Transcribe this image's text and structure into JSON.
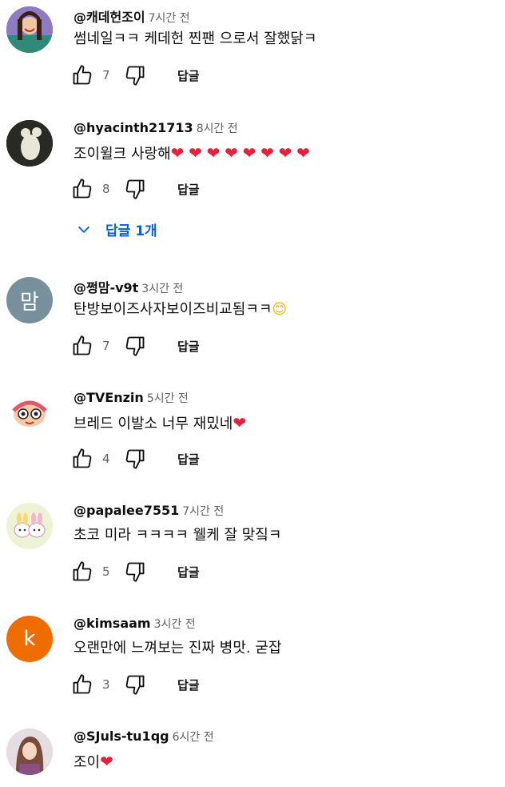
{
  "comments": [
    {
      "handle": "@캐데헌조이",
      "time": "7시간 전",
      "text": "썸네일ㅋㅋ 케데헌 찐팬 으로서  잘했닭ㅋ",
      "hearts": 0,
      "likes": "7",
      "reply": "답글",
      "avatar": {
        "type": "image",
        "bg": "#6b4fa0"
      }
    },
    {
      "handle": "@hyacinth21713",
      "time": "8시간 전",
      "text": "조이윌크 사랑해",
      "hearts": 8,
      "likes": "8",
      "reply": "답글",
      "replies_toggle": "답글 1개",
      "avatar": {
        "type": "image",
        "bg": "#1a1a1a"
      }
    },
    {
      "handle": "@쩡맘-v9t",
      "time": "3시간 전",
      "text": "탄방보이즈사자보이즈비교됨ㅋㅋ",
      "emoji": "😊",
      "likes": "7",
      "reply": "답글",
      "avatar": {
        "type": "letter",
        "letter": "맘",
        "bg": "#78909c"
      }
    },
    {
      "handle": "@TVEnzin",
      "time": "5시간 전",
      "text": "브레드 이발소 너무 재밌네",
      "hearts": 1,
      "likes": "4",
      "reply": "답글",
      "avatar": {
        "type": "image",
        "bg": "#ffffff"
      }
    },
    {
      "handle": "@papalee7551",
      "time": "7시간 전",
      "text": "초코 미라 ㅋㅋㅋㅋ 웰케 잘 맞짘ㅋ",
      "likes": "5",
      "reply": "답글",
      "avatar": {
        "type": "image",
        "bg": "#eef3d6"
      }
    },
    {
      "handle": "@kimsaam",
      "time": "3시간 전",
      "text": "오랜만에 느껴보는 진짜 병맛. 굳잡",
      "likes": "3",
      "reply": "답글",
      "avatar": {
        "type": "letter",
        "letter": "k",
        "bg": "#ef6c00"
      }
    },
    {
      "handle": "@SJuls-tu1qg",
      "time": "6시간 전",
      "text": "조이",
      "hearts": 1,
      "avatar": {
        "type": "image",
        "bg": "#d9cfd6"
      }
    }
  ],
  "colors": {
    "heart": "#e8213a",
    "link": "#065fd4",
    "muted": "#606060"
  }
}
